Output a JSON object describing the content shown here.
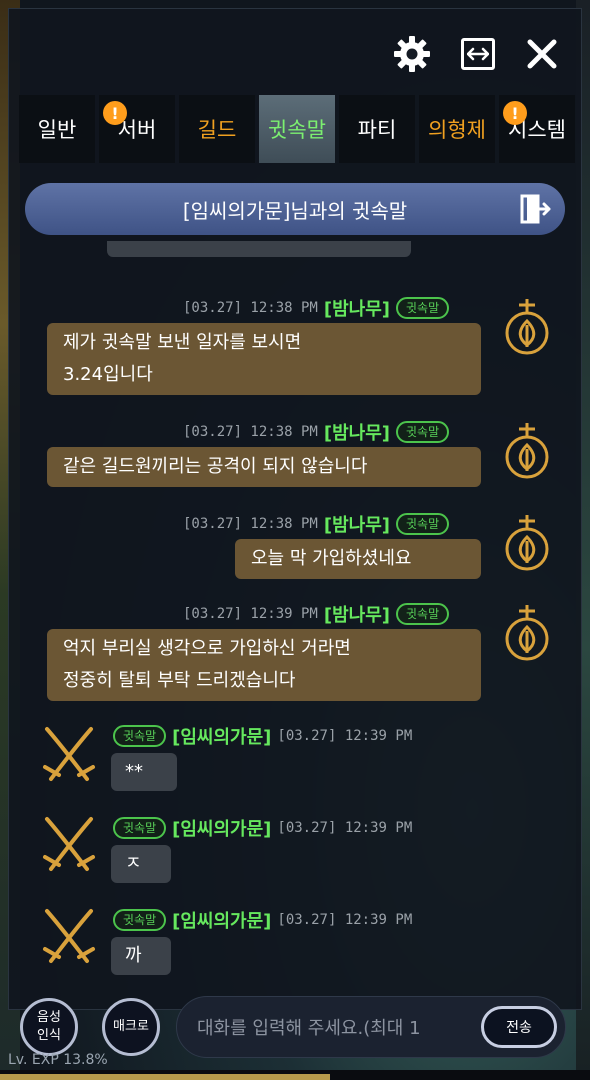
{
  "colors": {
    "accent_green": "#66e85e",
    "outgoing_bubble": "#6b5634",
    "incoming_bubble": "#3b4149",
    "badge_orange": "#ff9d1c",
    "header_blue": "#4f63a0"
  },
  "topbar": {
    "icons": [
      "gear-icon",
      "resize-icon",
      "close-icon"
    ]
  },
  "tabs": [
    {
      "label": "일반",
      "color": "#ffffff",
      "badge": ""
    },
    {
      "label": "서버",
      "color": "#ffffff",
      "badge": "!"
    },
    {
      "label": "길드",
      "color": "#f0a020",
      "badge": ""
    },
    {
      "label": "귓속말",
      "color": "#7cf070",
      "badge": "",
      "active": true
    },
    {
      "label": "파티",
      "color": "#ffffff",
      "badge": ""
    },
    {
      "label": "의형제",
      "color": "#f0a020",
      "badge": ""
    },
    {
      "label": "시스템",
      "color": "#ffffff",
      "badge": "!"
    }
  ],
  "header": {
    "title": "[임씨의가문]님과의 귓속말"
  },
  "messages": [
    {
      "dir": "out",
      "timestamp": "[03.27] 12:38 PM",
      "sender": "[밤나무]",
      "chip": "귓속말",
      "lines": [
        "제가 귓속말 보낸 일자를 보시면",
        "3.24입니다"
      ]
    },
    {
      "dir": "out",
      "timestamp": "[03.27] 12:38 PM",
      "sender": "[밤나무]",
      "chip": "귓속말",
      "lines": [
        "같은 길드원끼리는 공격이 되지 않습니다"
      ]
    },
    {
      "dir": "out",
      "timestamp": "[03.27] 12:38 PM",
      "sender": "[밤나무]",
      "chip": "귓속말",
      "lines": [
        "오늘 막 가입하셨네요"
      ]
    },
    {
      "dir": "out",
      "timestamp": "[03.27] 12:39 PM",
      "sender": "[밤나무]",
      "chip": "귓속말",
      "lines": [
        "억지 부리실 생각으로 가입하신 거라면",
        "정중히 탈퇴 부탁 드리겠습니다"
      ]
    },
    {
      "dir": "in",
      "timestamp": "[03.27] 12:39 PM",
      "sender": "[임씨의가문]",
      "chip": "귓속말",
      "lines": [
        "**"
      ]
    },
    {
      "dir": "in",
      "timestamp": "[03.27] 12:39 PM",
      "sender": "[임씨의가문]",
      "chip": "귓속말",
      "lines": [
        "ㅈ"
      ]
    },
    {
      "dir": "in",
      "timestamp": "[03.27] 12:39 PM",
      "sender": "[임씨의가문]",
      "chip": "귓속말",
      "lines": [
        "까"
      ]
    }
  ],
  "bottom": {
    "voice_label": "음성\n인식",
    "macro_label": "매크로",
    "input_placeholder": "대화를 입력해 주세요.(최대 1",
    "send_label": "전송",
    "status_text": "Lv.   EXP 13.8%"
  }
}
